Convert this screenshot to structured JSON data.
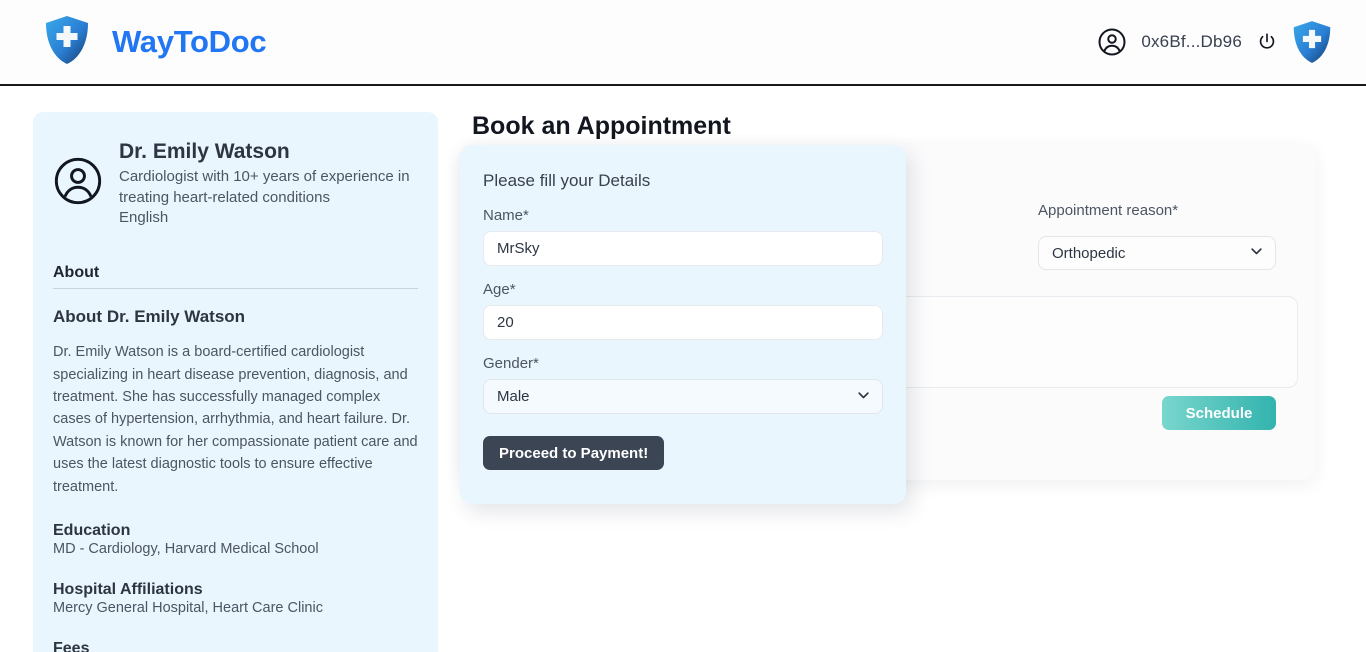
{
  "header": {
    "logo_icon": "shield-plus-icon",
    "brand": "WayToDoc",
    "account_icon": "user-circle-icon",
    "wallet_address": "0x6Bf...Db96",
    "power_icon": "power-icon",
    "right_logo_icon": "shield-plus-icon",
    "brand_color": "#2176f3"
  },
  "doctor": {
    "avatar_icon": "user-circle-icon",
    "name": "Dr. Emily Watson",
    "description": "Cardiologist with 10+ years of experience in treating heart-related conditions",
    "language": "English",
    "tab": "About",
    "about_heading": "About Dr. Emily Watson",
    "about_text": "Dr. Emily Watson is a board-certified cardiologist specializing in heart disease prevention, diagnosis, and treatment. She has successfully managed complex cases of hypertension, arrhythmia, and heart failure. Dr. Watson is known for her compassionate patient care and uses the latest diagnostic tools to ensure effective treatment.",
    "sections": [
      {
        "title": "Education",
        "body": "MD - Cardiology, Harvard Medical School"
      },
      {
        "title": "Hospital Affiliations",
        "body": "Mercy General Hospital, Heart Care Clinic"
      },
      {
        "title": "Fees",
        "body": ""
      }
    ]
  },
  "booking": {
    "title": "Book an Appointment",
    "reason_label": "Appointment reason*",
    "reason_value": "Orthopedic",
    "reason_options": [
      "Orthopedic"
    ],
    "notes_value": "",
    "notes_placeholder": "",
    "schedule_label": "Schedule",
    "schedule_color": "#33b3ae",
    "chevron_icon": "chevron-down-icon"
  },
  "modal": {
    "title": "Please fill your Details",
    "name_label": "Name*",
    "name_value": "MrSky",
    "name_placeholder": "",
    "age_label": "Age*",
    "age_value": "20",
    "age_placeholder": "",
    "gender_label": "Gender*",
    "gender_value": "Male",
    "gender_options": [
      "Male"
    ],
    "submit_label": "Proceed to Payment!",
    "chevron_icon": "chevron-down-icon"
  }
}
